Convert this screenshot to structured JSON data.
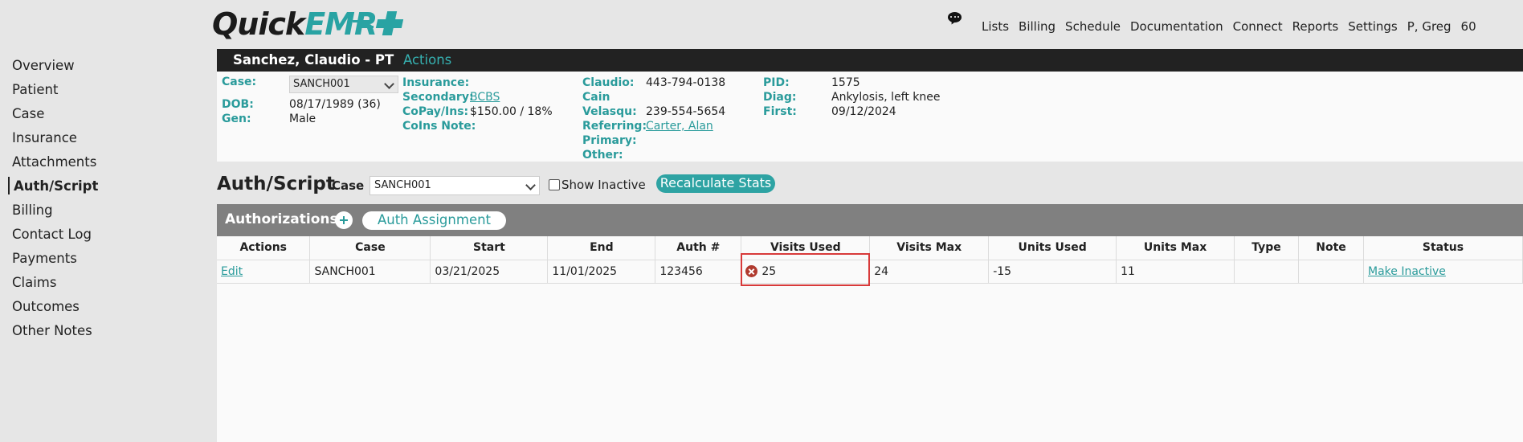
{
  "brand": {
    "part1": "Quick",
    "part2": "EMR"
  },
  "nav": [
    "Lists",
    "Billing",
    "Schedule",
    "Documentation",
    "Connect",
    "Reports",
    "Settings",
    "P, Greg",
    "60"
  ],
  "sidebar": [
    "Overview",
    "Patient",
    "Case",
    "Insurance",
    "Attachments",
    "Auth/Script",
    "Billing",
    "Contact Log",
    "Payments",
    "Claims",
    "Outcomes",
    "Other Notes"
  ],
  "patient": {
    "name": "Sanchez, Claudio - PT",
    "actions": "Actions",
    "case_label": "Case:",
    "case_value": "SANCH001",
    "dob_label": "DOB:",
    "dob_value": "08/17/1989 (36)",
    "gen_label": "Gen:",
    "gen_value": "Male",
    "insurance_label": "Insurance:",
    "secondary_label": "Secondary:",
    "secondary_value": "BCBS",
    "copay_label": "CoPay/Ins:",
    "copay_value": "$150.00 / 18%",
    "coins_label": "CoIns Note:",
    "contact1_label": "Claudio:",
    "contact1_value": "443-794-0138",
    "contact2_label": "Cain",
    "contact3_label": "Velasqu:",
    "contact3_value": "239-554-5654",
    "referring_label": "Referring:",
    "referring_value": "Carter, Alan",
    "primary_label": "Primary:",
    "other_label": "Other:",
    "pid_label": "PID:",
    "pid_value": "1575",
    "diag_label": "Diag:",
    "diag_value": "Ankylosis, left knee",
    "first_label": "First:",
    "first_value": "09/12/2024"
  },
  "auth_script": {
    "title": "Auth/Script",
    "case_label": "Case",
    "case_value": "SANCH001",
    "show_inactive": "Show Inactive",
    "recalc": "Recalculate Stats"
  },
  "authorizations": {
    "title": "Authorizations",
    "assign_button": "Auth Assignment",
    "headers": [
      "Actions",
      "Case",
      "Start",
      "End",
      "Auth #",
      "Visits Used",
      "Visits Max",
      "Units Used",
      "Units Max",
      "Type",
      "Note",
      "Status"
    ],
    "row": {
      "edit": "Edit",
      "case": "SANCH001",
      "start": "03/21/2025",
      "end": "11/01/2025",
      "auth": "123456",
      "visits_used": "25",
      "visits_max": "24",
      "units_used": "-15",
      "units_max": "11",
      "type": "",
      "note": "",
      "status": "Make Inactive"
    }
  },
  "colors": {
    "accent": "#2a9b9b",
    "header_bg": "#222222",
    "panel_head": "#808080",
    "error": "#d83a3a"
  }
}
